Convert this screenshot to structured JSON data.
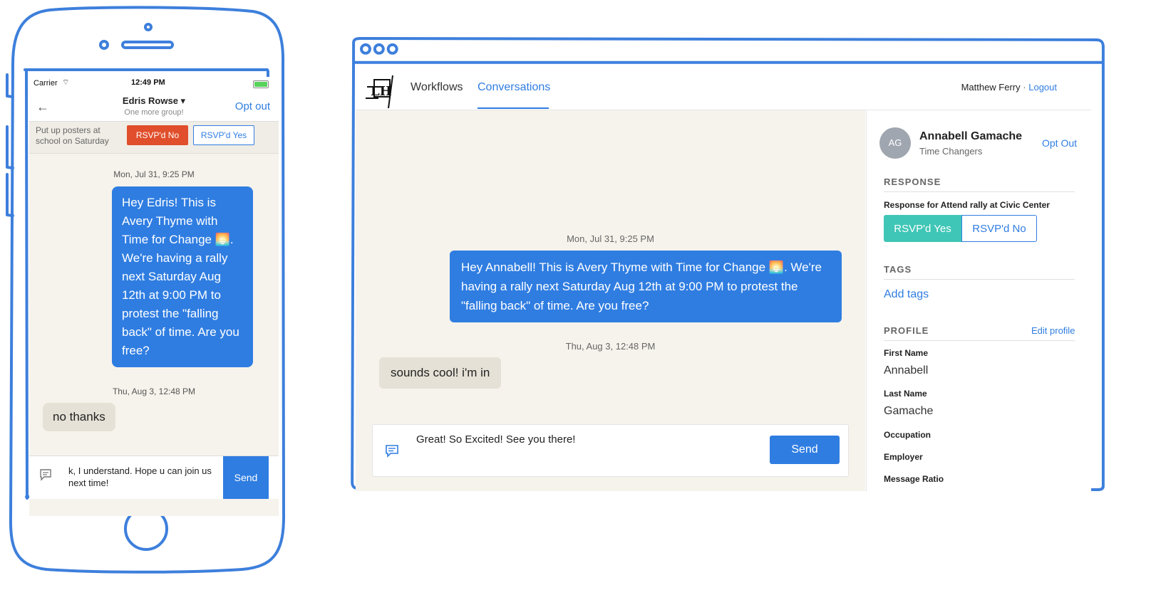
{
  "phone": {
    "status": {
      "carrier": "Carrier",
      "time": "12:49 PM"
    },
    "header": {
      "contact_name": "Edris Rowse ▾",
      "subtitle": "One more group!",
      "opt_out": "Opt out"
    },
    "task": {
      "text": "Put up posters at school on Saturday",
      "rsvp_no": "RSVP'd No",
      "rsvp_yes": "RSVP'd Yes"
    },
    "messages": [
      {
        "timestamp": "Mon, Jul 31, 9:25 PM",
        "text": "Hey Edris! This is Avery Thyme with Time for Change 🌅. We're having a rally next Saturday Aug 12th at 9:00 PM to protest the \"falling back\" of time. Are you free?"
      },
      {
        "timestamp": "Thu, Aug 3, 12:48 PM",
        "text": "no thanks"
      }
    ],
    "compose": {
      "text": "k, I understand. Hope u can join us next time!",
      "send": "Send"
    }
  },
  "browser": {
    "nav": {
      "workflows": "Workflows",
      "conversations": "Conversations",
      "user": "Matthew Ferry",
      "separator": "·",
      "logout": "Logout"
    },
    "messages": [
      {
        "timestamp": "Mon, Jul 31, 9:25 PM",
        "text": "Hey Annabell! This is Avery Thyme with Time for Change 🌅. We're having a rally next Saturday Aug 12th at 9:00 PM to protest the \"falling back\" of time. Are you free?"
      },
      {
        "timestamp": "Thu, Aug 3, 12:48 PM",
        "text": "sounds cool! i'm in"
      }
    ],
    "compose": {
      "text": "Great! So Excited! See you there!",
      "send": "Send"
    },
    "sidebar": {
      "avatar_initials": "AG",
      "name": "Annabell Gamache",
      "group": "Time Changers",
      "opt_out": "Opt Out",
      "response_heading": "RESPONSE",
      "response_for": "Response for Attend rally at Civic Center",
      "rsvp_yes": "RSVP'd Yes",
      "rsvp_no": "RSVP'd No",
      "tags_heading": "TAGS",
      "add_tags": "Add tags",
      "profile_heading": "PROFILE",
      "edit_profile": "Edit profile",
      "fields": {
        "first_name_label": "First Name",
        "first_name": "Annabell",
        "last_name_label": "Last Name",
        "last_name": "Gamache",
        "occupation_label": "Occupation",
        "employer_label": "Employer",
        "message_ratio_label": "Message Ratio"
      }
    }
  },
  "colors": {
    "accent": "#2f7de1",
    "rsvp_no_phone": "#e04e2b",
    "rsvp_yes_active": "#3fc6b6",
    "conversation_bg": "#f6f3ec",
    "sketch_outline": "#3d7fdc"
  }
}
